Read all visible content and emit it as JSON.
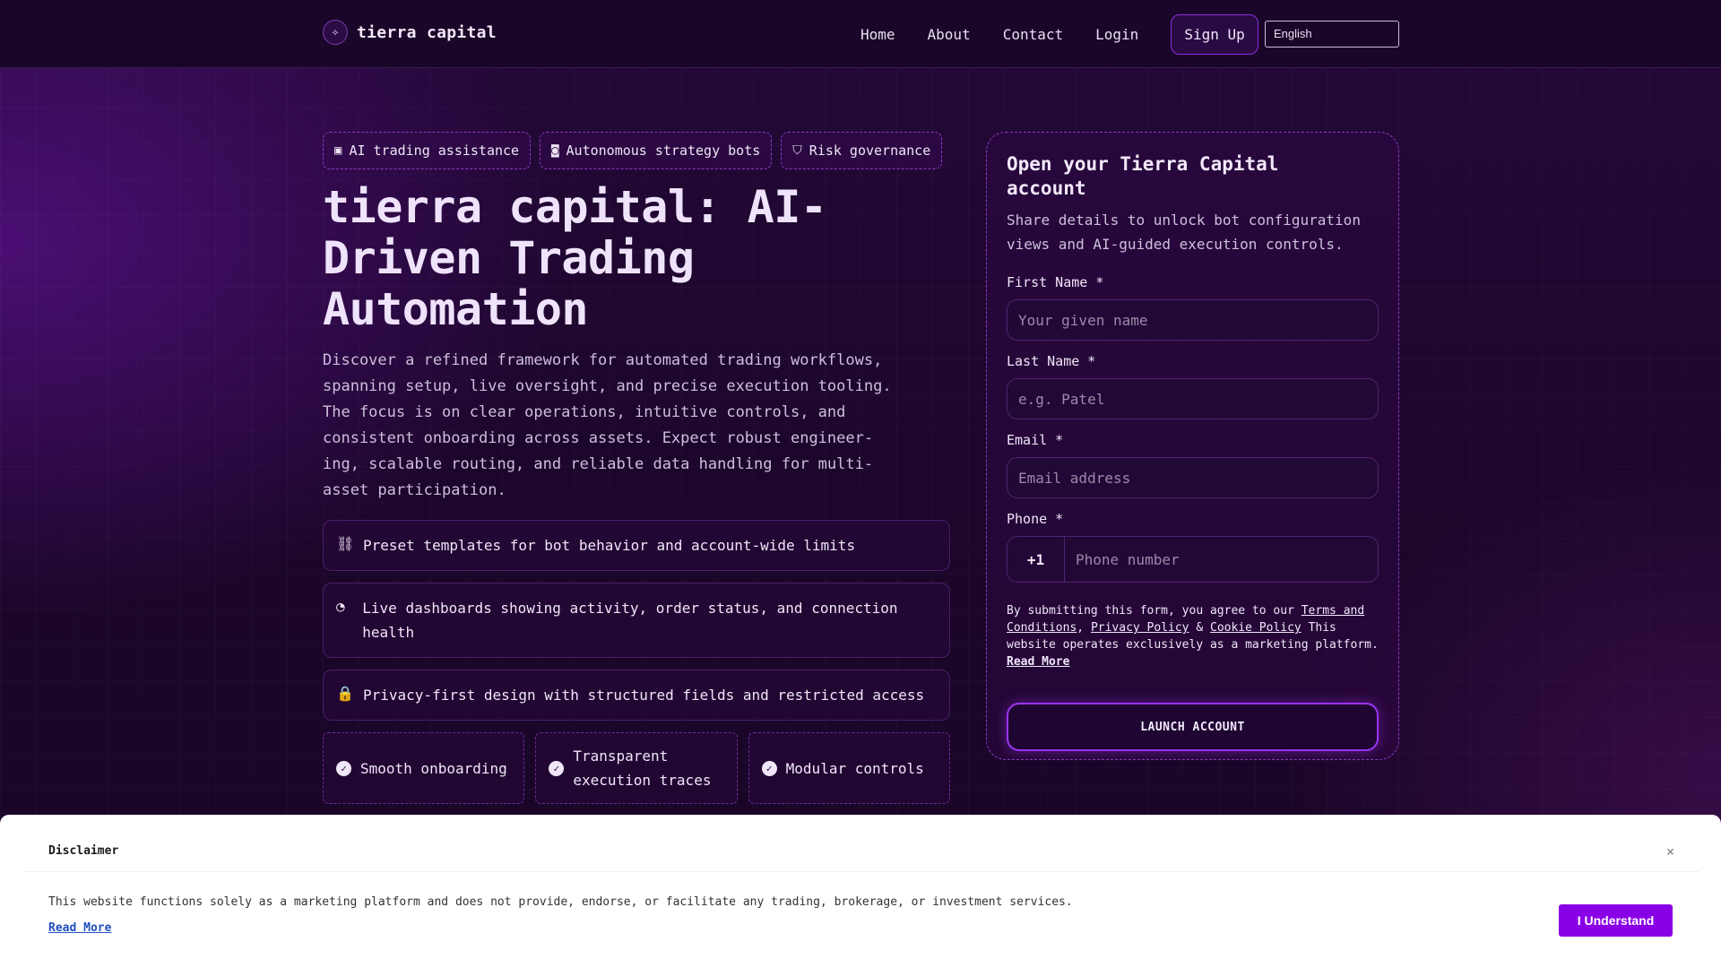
{
  "header": {
    "brand_mark": "✧",
    "brand_name": "tierra capital",
    "nav": [
      {
        "label": "Home"
      },
      {
        "label": "About"
      },
      {
        "label": "Contact"
      },
      {
        "label": "Login"
      }
    ],
    "signup_label": "Sign Up",
    "language": "English"
  },
  "hero": {
    "pills": [
      {
        "icon": "chip-icon",
        "glyph": "▣",
        "label": "AI trading assistance"
      },
      {
        "icon": "robot-icon",
        "glyph": "◙",
        "label": "Autonomous strategy bots"
      },
      {
        "icon": "shield-icon",
        "glyph": "⛉",
        "label": "Risk governance"
      }
    ],
    "headline": "tierra capital: AI-Driven Trading Automation",
    "intro": "Discover a refined framework for automated trading workflows, spanning setup, live oversight, and precise execution tooling. The focus is on clear operations, intuitive controls, and consistent onboarding across assets. Expect robust engineer-ing, scalable routing, and reliable data handling for multi-asset participation.",
    "features": [
      {
        "icon": "nodes-icon",
        "glyph": "⛓",
        "text": "Preset templates for bot behavior and account-wide limits"
      },
      {
        "icon": "gauge-icon",
        "glyph": "◔",
        "text": "Live dashboards showing activity, order status, and connection health"
      },
      {
        "icon": "lock-icon",
        "glyph": "🔒",
        "text": "Privacy-first design with structured fields and restricted access"
      }
    ],
    "checks": [
      {
        "icon": "check-circle-icon",
        "glyph": "✓",
        "text": "Smooth onboarding"
      },
      {
        "icon": "check-circle-icon",
        "glyph": "✓",
        "text": "Transparent execution traces"
      },
      {
        "icon": "check-circle-icon",
        "glyph": "✓",
        "text": "Modular controls"
      }
    ]
  },
  "form": {
    "title": "Open your Tierra Capital account",
    "subtitle": "Share details to unlock bot configuration views and AI-guided execution controls.",
    "first_name_label": "First Name *",
    "first_name_placeholder": "Your given name",
    "last_name_label": "Last Name *",
    "last_name_placeholder": "e.g. Patel",
    "email_label": "Email *",
    "email_placeholder": "Email address",
    "phone_label": "Phone *",
    "phone_code": "+1",
    "phone_placeholder": "Phone number",
    "legal_prefix": "By submitting this form, you agree to our ",
    "terms_link": "Terms and Conditions",
    "comma": ", ",
    "privacy_link": "Privacy Policy",
    "amp": " & ",
    "cookie_link": "Cookie Policy",
    "legal_suffix": " This website operates exclusively as a marketing platform. ",
    "read_more": "Read More",
    "submit_label": "LAUNCH ACCOUNT"
  },
  "disclaimer": {
    "title": "Disclaimer",
    "close": "×",
    "text": "This website functions solely as a marketing platform and does not provide, endorse, or facilitate any trading, brokerage, or investment services.",
    "read_more": "Read More",
    "button": "I Understand"
  },
  "colors": {
    "background": "#1a0628",
    "accent": "#8a00e6",
    "border": "#8a3bc4"
  }
}
